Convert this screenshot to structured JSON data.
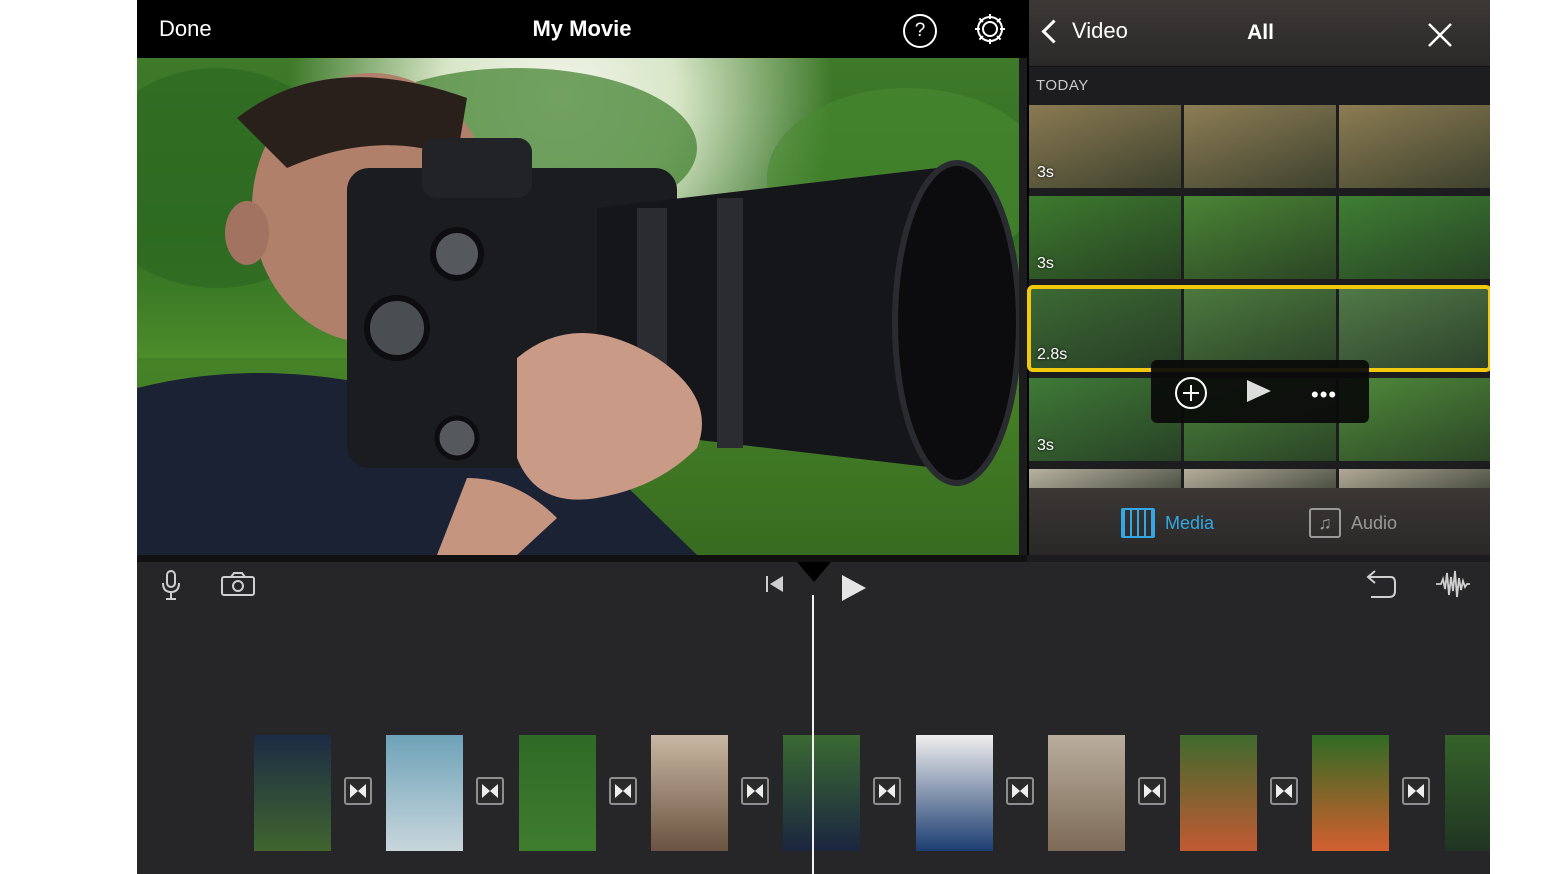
{
  "viewer": {
    "done_label": "Done",
    "title": "My Movie",
    "help_label": "?",
    "settings_icon": "gear-icon"
  },
  "browser": {
    "back_label": "Video",
    "title": "All",
    "section_label": "TODAY",
    "rows": [
      {
        "duration": "3s",
        "colors": [
          "#8a7a52",
          "#8d7d55",
          "#8c7c53"
        ]
      },
      {
        "duration": "3s",
        "colors": [
          "#3d7a2e",
          "#4a8535",
          "#3e7f33"
        ]
      },
      {
        "duration": "2.8s",
        "colors": [
          "#3c6a34",
          "#4c7a3e",
          "#517a48"
        ]
      },
      {
        "duration": "3s",
        "colors": [
          "#3f7a37",
          "#4a843b",
          "#4f8a3a"
        ]
      },
      {
        "duration": "",
        "colors": [
          "#b9b2a0",
          "#b6ad9b",
          "#b2a996"
        ]
      }
    ],
    "selected_row": 2,
    "tabs": {
      "media_label": "Media",
      "audio_label": "Audio"
    },
    "accent_color": "#33a8e5",
    "selection_color": "#f3c90d"
  },
  "popup": {
    "more_label": "•••"
  },
  "timeline": {
    "clips": [
      {
        "colors": [
          "#1c2b45",
          "#40652f"
        ]
      },
      {
        "colors": [
          "#6ea2b8",
          "#c8d6dc"
        ]
      },
      {
        "colors": [
          "#2f6a26",
          "#3f7d2f"
        ]
      },
      {
        "colors": [
          "#c8b7a2",
          "#6a5340"
        ]
      },
      {
        "colors": [
          "#3a6a32",
          "#1b2540"
        ]
      },
      {
        "colors": [
          "#efeeee",
          "#1c3d71"
        ]
      },
      {
        "colors": [
          "#b9ad9d",
          "#7d6a57"
        ]
      },
      {
        "colors": [
          "#3f6a2d",
          "#c25a33"
        ]
      },
      {
        "colors": [
          "#2f6b23",
          "#d45f30"
        ]
      },
      {
        "colors": [
          "#35622a",
          "#203523"
        ]
      }
    ]
  }
}
